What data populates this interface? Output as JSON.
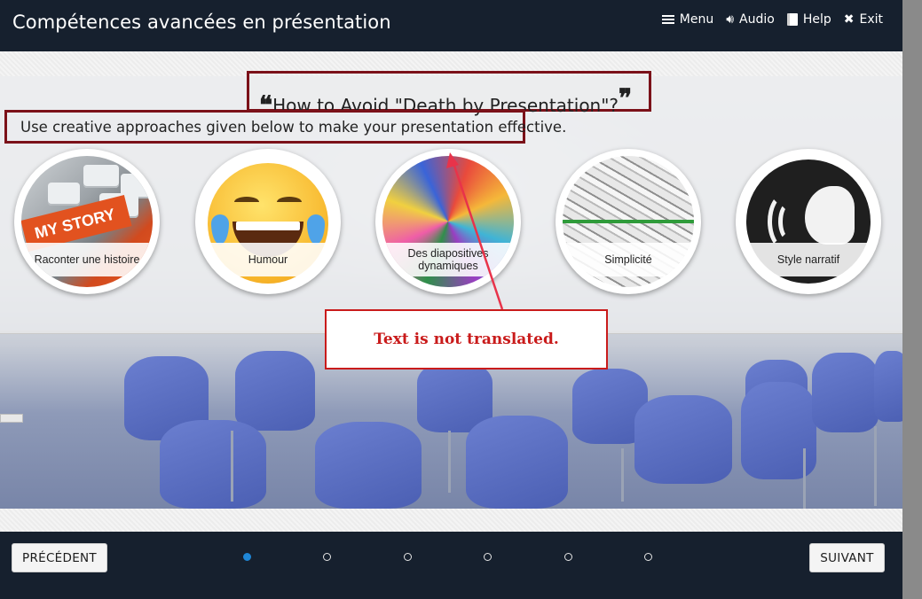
{
  "header": {
    "title": "Compétences avancées en présentation",
    "nav": [
      {
        "label": "Menu",
        "icon": "menu-icon"
      },
      {
        "label": "Audio",
        "icon": "speaker-icon"
      },
      {
        "label": "Help",
        "icon": "book-icon"
      },
      {
        "label": "Exit",
        "icon": "close-icon"
      }
    ]
  },
  "slide": {
    "heading": "How to Avoid \"Death by Presentation\"?",
    "open_quote": "❝",
    "close_quote": "❞",
    "subtitle": "Use creative approaches given below to make your presentation effective.",
    "cards": [
      {
        "label": "Raconter une histoire",
        "image": "my-story-keyboard",
        "key_text": "MY STORY"
      },
      {
        "label": "Humour",
        "image": "laughing-emoji"
      },
      {
        "label": "Des diapositives dynamiques",
        "image": "colorful-paint-swirl"
      },
      {
        "label": "Simplicité",
        "image": "maze-with-green-line"
      },
      {
        "label": "Style narratif",
        "image": "speaking-head"
      }
    ]
  },
  "annotation": {
    "text": "Text is not translated.",
    "color": "#c91b1b"
  },
  "footer": {
    "prev_label": "PRÉCÉDENT",
    "next_label": "SUIVANT",
    "pages": 6,
    "active_page": 1
  },
  "colors": {
    "header_bg": "#16202e",
    "highlight_border": "#7b1119",
    "active_dot": "#1f86d6"
  }
}
